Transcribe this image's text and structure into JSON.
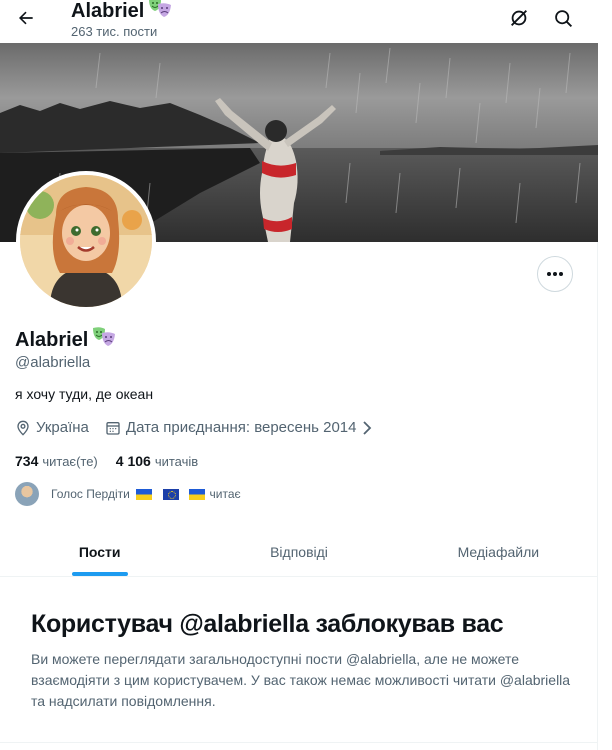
{
  "header": {
    "title": "Alabriel",
    "post_count": "263 тис. пости"
  },
  "profile": {
    "display_name": "Alabriel",
    "handle": "@alabriella",
    "bio": "я хочу туди, де океан",
    "location": "Україна",
    "join_date": "Дата приєднання: вересень 2014",
    "following_count": "734",
    "following_label": "читає(те)",
    "followers_count": "4 106",
    "followers_label": "читачів",
    "known_follower_name": "Голос Пердіти",
    "known_follower_suffix": "читає"
  },
  "tabs": [
    {
      "label": "Пости",
      "active": true
    },
    {
      "label": "Відповіді",
      "active": false
    },
    {
      "label": "Медіафайли",
      "active": false
    }
  ],
  "blocked_notice": {
    "title": "Користувач @alabriella заблокував вас",
    "text": "Ви можете переглядати загальнодоступні пости @alabriella, але не можете взаємодіяти з цим користувачем. У вас також немає можливості читати @alabriella та надсилати повідомлення."
  },
  "icons": {
    "back": "arrow-left-icon",
    "hide": "eye-slash-icon",
    "search": "search-icon",
    "more": "more-dots-icon",
    "location": "location-pin-icon",
    "calendar": "calendar-icon",
    "chevron": "chevron-right-icon",
    "badge": "theatre-masks-icon"
  },
  "colors": {
    "accent": "#1d9bf0",
    "text_primary": "#0f1419",
    "text_secondary": "#536471"
  }
}
